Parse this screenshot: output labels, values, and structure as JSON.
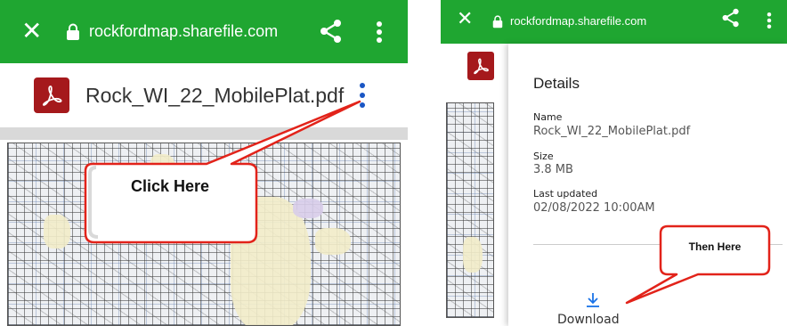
{
  "left": {
    "urlbar": {
      "close_glyph": "✕",
      "url": "rockfordmap.sharefile.com",
      "lock_icon": "lock-icon",
      "share_icon": "share-icon",
      "menu_icon": "more-vert-icon"
    },
    "file": {
      "name": "Rock_WI_22_MobilePlat.pdf",
      "icon": "pdf-icon",
      "menu_icon": "more-vert-icon"
    },
    "callout": {
      "text": "Click Here"
    }
  },
  "right": {
    "urlbar": {
      "close_glyph": "✕",
      "url": "rockfordmap.sharefile.com",
      "lock_icon": "lock-icon",
      "share_icon": "share-icon",
      "menu_icon": "more-vert-icon"
    },
    "details": {
      "title": "Details",
      "name_label": "Name",
      "name_value": "Rock_WI_22_MobilePlat.pdf",
      "size_label": "Size",
      "size_value": "3.8 MB",
      "updated_label": "Last updated",
      "updated_value": "02/08/2022 10:00AM",
      "download_label": "Download"
    },
    "callout": {
      "text": "Then Here"
    }
  },
  "colors": {
    "toolbar_green": "#1fa631",
    "pdf_red": "#a5191c",
    "callout_red": "#e2231a",
    "download_blue": "#1a73e8",
    "menu_blue": "#1a56c4"
  }
}
